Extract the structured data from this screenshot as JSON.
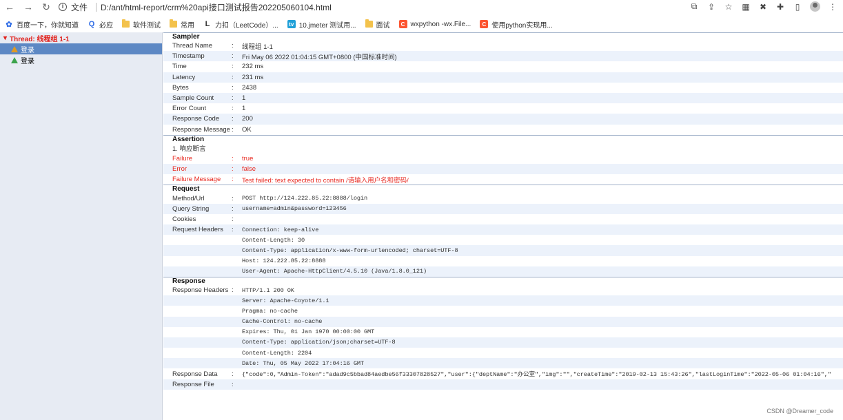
{
  "browser": {
    "url_prefix": "文件",
    "url": "D:/ant/html-report/crm%20api接口测试报告202205060104.html",
    "bookmarks": [
      {
        "label": "百度一下，你就知道",
        "icon": "baidu-icon",
        "color": "#2f6ce5"
      },
      {
        "label": "必应",
        "icon": "search-icon",
        "color": "#2f6ce5"
      },
      {
        "label": "软件测试",
        "icon": "folder-icon",
        "color": "#f3c24c"
      },
      {
        "label": "常用",
        "icon": "folder-icon",
        "color": "#f3c24c"
      },
      {
        "label": "力扣（LeetCode）...",
        "icon": "leetcode-icon",
        "color": "#f89e1b"
      },
      {
        "label": "10.jmeter 测试用...",
        "icon": "bilibili-icon",
        "color": "#20a0d8"
      },
      {
        "label": "面试",
        "icon": "folder-icon",
        "color": "#f3c24c"
      },
      {
        "label": "wxpython -wx.File...",
        "icon": "csdn-icon",
        "color": "#fc5531"
      },
      {
        "label": "使用python实现用...",
        "icon": "csdn-icon",
        "color": "#fc5531"
      }
    ]
  },
  "tree": {
    "root": "Thread: 线程组 1-1",
    "items": [
      {
        "label": "登录",
        "state": "failed"
      },
      {
        "label": "登录",
        "state": "passed"
      }
    ]
  },
  "sampler": {
    "title": "Sampler",
    "rows": [
      {
        "key": "Thread Name",
        "value": "线程组 1-1"
      },
      {
        "key": "Timestamp",
        "value": "Fri May 06 2022 01:04:15 GMT+0800 (中国标准时间)"
      },
      {
        "key": "Time",
        "value": "232 ms"
      },
      {
        "key": "Latency",
        "value": "231 ms"
      },
      {
        "key": "Bytes",
        "value": "2438"
      },
      {
        "key": "Sample Count",
        "value": "1"
      },
      {
        "key": "Error Count",
        "value": "1"
      },
      {
        "key": "Response Code",
        "value": "200"
      },
      {
        "key": "Response Message",
        "value": "OK"
      }
    ]
  },
  "assertion": {
    "title": "Assertion",
    "name": "1. 响应断言",
    "rows": [
      {
        "key": "Failure",
        "value": "true"
      },
      {
        "key": "Error",
        "value": "false"
      },
      {
        "key": "Failure Message",
        "value": "Test failed: text expected to contain /请输入用户名和密码/"
      }
    ]
  },
  "request": {
    "title": "Request",
    "rows": [
      {
        "key": "Method/Url",
        "value": "POST http://124.222.85.22:8888/login"
      },
      {
        "key": "Query String",
        "value": "username=admin&password=123456"
      },
      {
        "key": "Cookies",
        "value": ""
      },
      {
        "key": "Request Headers",
        "value": "Connection: keep-alive"
      },
      {
        "key": "",
        "value": "Content-Length: 30"
      },
      {
        "key": "",
        "value": "Content-Type: application/x-www-form-urlencoded; charset=UTF-8"
      },
      {
        "key": "",
        "value": "Host: 124.222.85.22:8888"
      },
      {
        "key": "",
        "value": "User-Agent: Apache-HttpClient/4.5.10 (Java/1.8.0_121)"
      }
    ]
  },
  "response": {
    "title": "Response",
    "rows": [
      {
        "key": "Response Headers",
        "value": "HTTP/1.1 200 OK"
      },
      {
        "key": "",
        "value": "Server: Apache-Coyote/1.1"
      },
      {
        "key": "",
        "value": "Pragma: no-cache"
      },
      {
        "key": "",
        "value": "Cache-Control: no-cache"
      },
      {
        "key": "",
        "value": "Expires: Thu, 01 Jan 1970 00:00:00 GMT"
      },
      {
        "key": "",
        "value": "Content-Type: application/json;charset=UTF-8"
      },
      {
        "key": "",
        "value": "Content-Length: 2204"
      },
      {
        "key": "",
        "value": "Date: Thu, 05 May 2022 17:04:16 GMT"
      },
      {
        "key": "Response Data",
        "value": "{\"code\":0,\"Admin-Token\":\"adad9c5bbad84aedbe56f33307828527\",\"user\":{\"deptName\":\"办公室\",\"img\":\"\",\"createTime\":\"2019-02-13 15:43:26\",\"lastLoginTime\":\"2022-05-06 01:04:16\",\""
      },
      {
        "key": "Response File",
        "value": ""
      }
    ]
  },
  "watermark": "CSDN @Dreamer_code"
}
